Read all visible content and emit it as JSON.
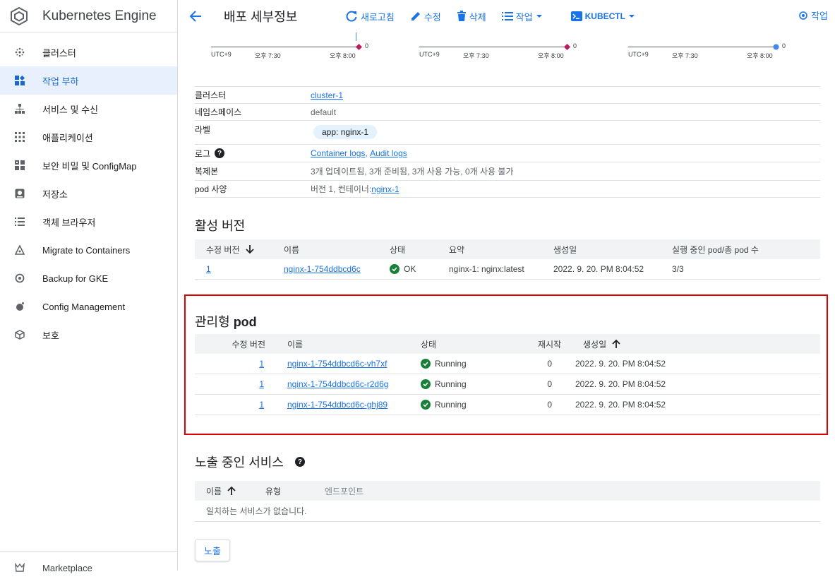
{
  "sidebar": {
    "title": "Kubernetes Engine",
    "items": [
      {
        "label": "클러스터",
        "icon": "cluster-icon"
      },
      {
        "label": "작업 부하",
        "icon": "workloads-icon",
        "active": true
      },
      {
        "label": "서비스 및 수신",
        "icon": "services-icon"
      },
      {
        "label": "애플리케이션",
        "icon": "applications-icon"
      },
      {
        "label": "보안 비밀 및 ConfigMap",
        "icon": "secrets-icon"
      },
      {
        "label": "저장소",
        "icon": "storage-icon"
      },
      {
        "label": "객체 브라우저",
        "icon": "object-browser-icon"
      },
      {
        "label": "Migrate to Containers",
        "icon": "migrate-icon"
      },
      {
        "label": "Backup for GKE",
        "icon": "backup-icon"
      },
      {
        "label": "Config Management",
        "icon": "config-management-icon"
      },
      {
        "label": "보호",
        "icon": "protection-icon"
      }
    ],
    "bottom_item": "Marketplace"
  },
  "topbar": {
    "title": "배포 세부정보",
    "refresh": "새로고침",
    "edit": "수정",
    "delete": "삭제",
    "actions": "작업",
    "kubectl": "KUBECTL",
    "right_action": "작업"
  },
  "mini_charts": [
    {
      "ticks": [
        "UTC+9",
        "오후 7:30",
        "오후 8:00"
      ],
      "zero": "0",
      "marker": "diamond",
      "marker_color": "#c2185b"
    },
    {
      "ticks": [
        "UTC+9",
        "오후 7:30",
        "오후 8:00"
      ],
      "zero": "0",
      "marker": "diamond",
      "marker_color": "#c2185b"
    },
    {
      "ticks": [
        "UTC+9",
        "오후 7:30",
        "오후 8:00"
      ],
      "zero": "0",
      "marker": "dot",
      "marker_color": "#4285f4"
    }
  ],
  "details": {
    "cluster_label": "클러스터",
    "cluster_value": "cluster-1",
    "namespace_label": "네임스페이스",
    "namespace_value": "default",
    "labels_label": "라벨",
    "labels_chip": "app: nginx-1",
    "logs_label": "로그",
    "logs_container": "Container logs",
    "logs_sep": ", ",
    "logs_audit": "Audit logs",
    "replicas_label": "복제본",
    "replicas_value": "3개 업데이트됨, 3개 준비됨, 3개 사용 가능, 0개 사용 불가",
    "podspec_label": "pod 사양",
    "podspec_prefix": "버전 1, 컨테이너:",
    "podspec_link": "nginx-1"
  },
  "active_revisions": {
    "title": "활성 버전",
    "headers": {
      "revision": "수정 버전",
      "name": "이름",
      "status": "상태",
      "summary": "요약",
      "created": "생성일",
      "pods": "실행 중인 pod/총 pod 수"
    },
    "rows": [
      {
        "revision": "1",
        "name": "nginx-1-754ddbcd6c",
        "status": "OK",
        "summary": "nginx-1: nginx:latest",
        "created": "2022. 9. 20. PM 8:04:52",
        "pods": "3/3"
      }
    ]
  },
  "managed_pods": {
    "title_prefix": "관리형 ",
    "title_bold": "pod",
    "headers": {
      "revision": "수정 버전",
      "name": "이름",
      "status": "상태",
      "restarts": "재시작",
      "created": "생성일"
    },
    "rows": [
      {
        "revision": "1",
        "name": "nginx-1-754ddbcd6c-vh7xf",
        "status": "Running",
        "restarts": "0",
        "created": "2022. 9. 20. PM 8:04:52"
      },
      {
        "revision": "1",
        "name": "nginx-1-754ddbcd6c-r2d6g",
        "status": "Running",
        "restarts": "0",
        "created": "2022. 9. 20. PM 8:04:52"
      },
      {
        "revision": "1",
        "name": "nginx-1-754ddbcd6c-ghj89",
        "status": "Running",
        "restarts": "0",
        "created": "2022. 9. 20. PM 8:04:52"
      }
    ]
  },
  "exposed_services": {
    "title": "노출 중인 서비스",
    "headers": {
      "name": "이름",
      "type": "유형",
      "endpoints": "엔드포인트"
    },
    "empty": "일치하는 서비스가 없습니다.",
    "expose_button": "노출"
  },
  "colors": {
    "accent": "#1a73e8",
    "ok": "#188038",
    "highlight": "#e00000"
  }
}
